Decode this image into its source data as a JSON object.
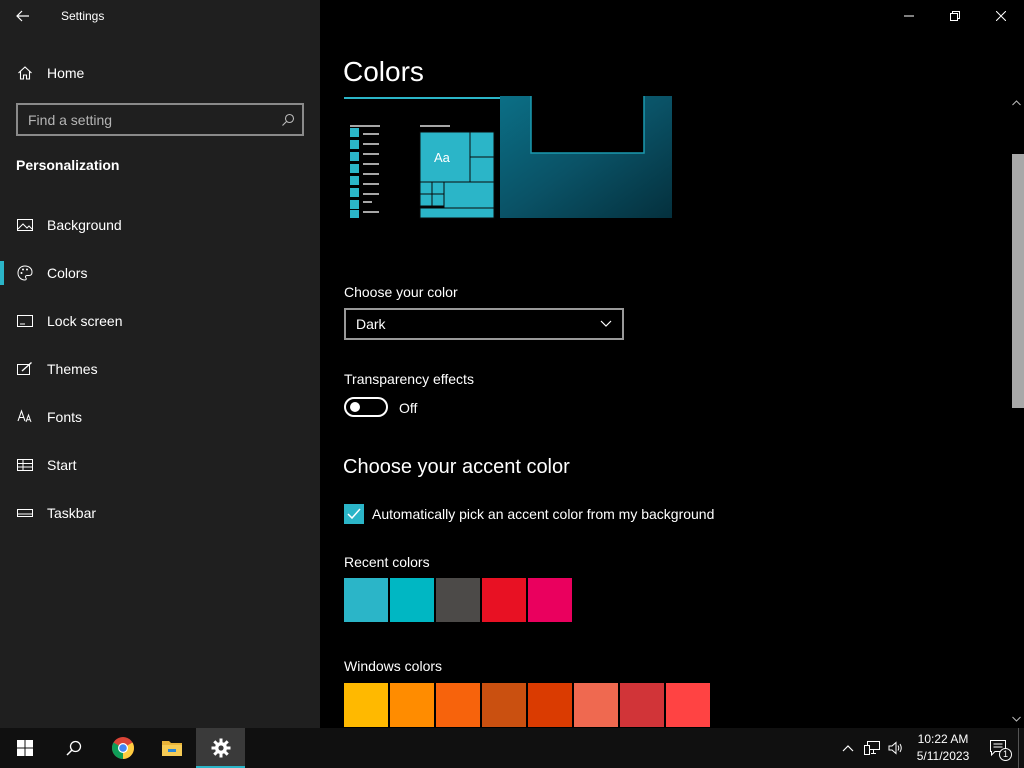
{
  "window": {
    "title": "Settings"
  },
  "sidebar": {
    "home_label": "Home",
    "search_placeholder": "Find a setting",
    "section_title": "Personalization",
    "items": [
      {
        "label": "Background",
        "icon": "picture-icon"
      },
      {
        "label": "Colors",
        "icon": "palette-icon",
        "selected": true
      },
      {
        "label": "Lock screen",
        "icon": "lock-screen-icon"
      },
      {
        "label": "Themes",
        "icon": "brush-icon"
      },
      {
        "label": "Fonts",
        "icon": "fonts-icon"
      },
      {
        "label": "Start",
        "icon": "start-icon"
      },
      {
        "label": "Taskbar",
        "icon": "taskbar-icon"
      }
    ]
  },
  "main": {
    "page_title": "Colors",
    "preview_sample_text": "Aa",
    "choose_color_label": "Choose your color",
    "choose_color_value": "Dark",
    "transparency_label": "Transparency effects",
    "transparency_state": "Off",
    "accent_heading": "Choose your accent color",
    "auto_pick_label": "Automatically pick an accent color from my background",
    "auto_pick_checked": true,
    "recent_colors_label": "Recent colors",
    "recent_colors": [
      "#2bb5c8",
      "#00b7c3",
      "#4c4a48",
      "#e81123",
      "#ea005e"
    ],
    "windows_colors_label": "Windows colors",
    "windows_colors": [
      "#ffb900",
      "#ff8c00",
      "#f7630c",
      "#ca5010",
      "#da3b01",
      "#ef6950",
      "#d13438",
      "#ff4343"
    ]
  },
  "colors": {
    "accent": "#2bb5c8",
    "sidebar_bg": "#1f1f1f",
    "main_bg": "#000000",
    "taskbar_bg": "#101010"
  },
  "taskbar": {
    "apps": [
      "start-icon",
      "search-icon",
      "chrome-icon",
      "file-explorer-icon",
      "settings-icon"
    ],
    "time": "10:22 AM",
    "date": "5/11/2023",
    "notification_count": "1"
  }
}
